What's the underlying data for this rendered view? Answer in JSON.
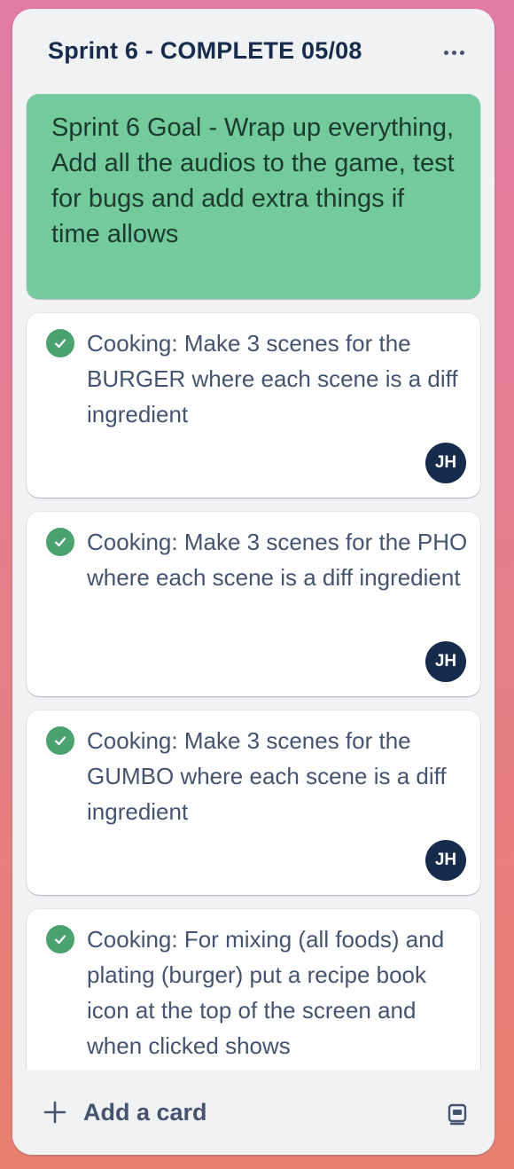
{
  "list": {
    "title": "Sprint 6 - COMPLETE 05/08",
    "menu_icon": "more-horizontal-icon"
  },
  "cards": [
    {
      "type": "goal",
      "label_color": "#73cb9b",
      "title": "Sprint 6 Goal - Wrap up everything, Add all the audios to the game, test for bugs and add extra things if time allows"
    },
    {
      "type": "task",
      "completed": true,
      "title": "Cooking: Make 3 scenes for the BURGER where each scene is a diff ingredient",
      "member_initials": "JH"
    },
    {
      "type": "task",
      "completed": true,
      "title": "Cooking: Make 3 scenes for the PHO where each scene is a diff ingredient",
      "member_initials": "JH"
    },
    {
      "type": "task",
      "completed": true,
      "title": "Cooking: Make 3 scenes for the GUMBO where each scene is a diff ingredient",
      "member_initials": "JH"
    },
    {
      "type": "task",
      "completed": true,
      "title": "Cooking: For mixing (all foods) and plating (burger) put a recipe book icon at the top of the screen and when clicked shows"
    }
  ],
  "footer": {
    "add_card_label": "Add a card",
    "add_icon": "plus-icon",
    "template_icon": "card-template-icon"
  },
  "colors": {
    "background_top": "#e27ba4",
    "background_bottom": "#e7806f",
    "list_bg": "#f1f2f4",
    "check_green": "#4aa26f",
    "avatar_bg": "#172b4d"
  }
}
